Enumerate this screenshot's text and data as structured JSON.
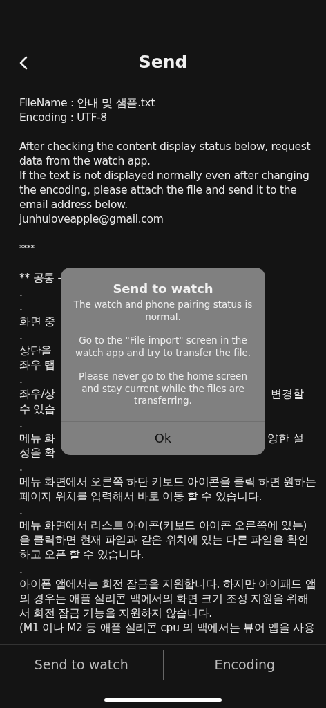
{
  "header": {
    "title": "Send"
  },
  "content": {
    "lines": [
      {
        "text": "FileName : 안내 및 샘플.txt"
      },
      {
        "text": "Encoding : UTF-8"
      },
      {
        "kind": "blank"
      },
      {
        "text": "After checking the content display status below, request"
      },
      {
        "text": "data from the watch app."
      },
      {
        "text": "If the text is not displayed normally even after changing"
      },
      {
        "text": "the encoding, please attach the file and send it to the"
      },
      {
        "text": "email address below."
      },
      {
        "text": "junhuloveapple@gmail.com"
      },
      {
        "kind": "blank"
      },
      {
        "text": "****",
        "kind": "small"
      },
      {
        "kind": "blank"
      },
      {
        "text": "** 공통 -"
      },
      {
        "text": "."
      },
      {
        "text": "."
      },
      {
        "text": "화면 중"
      },
      {
        "text": "."
      },
      {
        "text": "상단을"
      },
      {
        "text": "좌우 탭"
      },
      {
        "text": "."
      },
      {
        "text": "좌우/상",
        "right": "변경할"
      },
      {
        "text": "수 있습"
      },
      {
        "text": "."
      },
      {
        "text": "메뉴 화",
        "right": "양한 설"
      },
      {
        "text": "정을 확"
      },
      {
        "text": "."
      },
      {
        "text": "메뉴 화면에서 오른쪽 하단 키보드 아이콘을 클릭 하면 원하는"
      },
      {
        "text": "페이지 위치를 입력해서 바로 이동 할 수 있습니다."
      },
      {
        "text": "."
      },
      {
        "text": "메뉴 화면에서 리스트 아이콘(키보드 아이콘 오른쪽에 있는)"
      },
      {
        "text": "을 클릭하면 현재 파일과 같은 위치에 있는 다른 파일을 확인"
      },
      {
        "text": "하고 오픈 할 수 있습니다."
      },
      {
        "text": "."
      },
      {
        "text": "아이폰 앱에서는 회전 잠금을 지원합니다. 하지만 아이패드 앱"
      },
      {
        "text": "의 경우는 애플 실리콘 맥에서의 화면 크기 조정 지원을 위해"
      },
      {
        "text": "서 회전 잠금 기능을 지원하지 않습니다."
      },
      {
        "text": "(M1 이나 M2 등 애플 실리콘 cpu 의 맥에서는 뷰어 앱을 사용"
      }
    ]
  },
  "dialog": {
    "title": "Send to watch",
    "paragraphs": [
      "The watch and phone pairing status is normal.",
      "Go to the \"File import\" screen in the watch app and try to transfer the file.",
      "Please never go to the home screen and stay current while the files are transferring."
    ],
    "button": "Ok"
  },
  "bottom_bar": {
    "buttons": [
      {
        "label": "Send to watch"
      },
      {
        "label": "Encoding"
      }
    ]
  }
}
